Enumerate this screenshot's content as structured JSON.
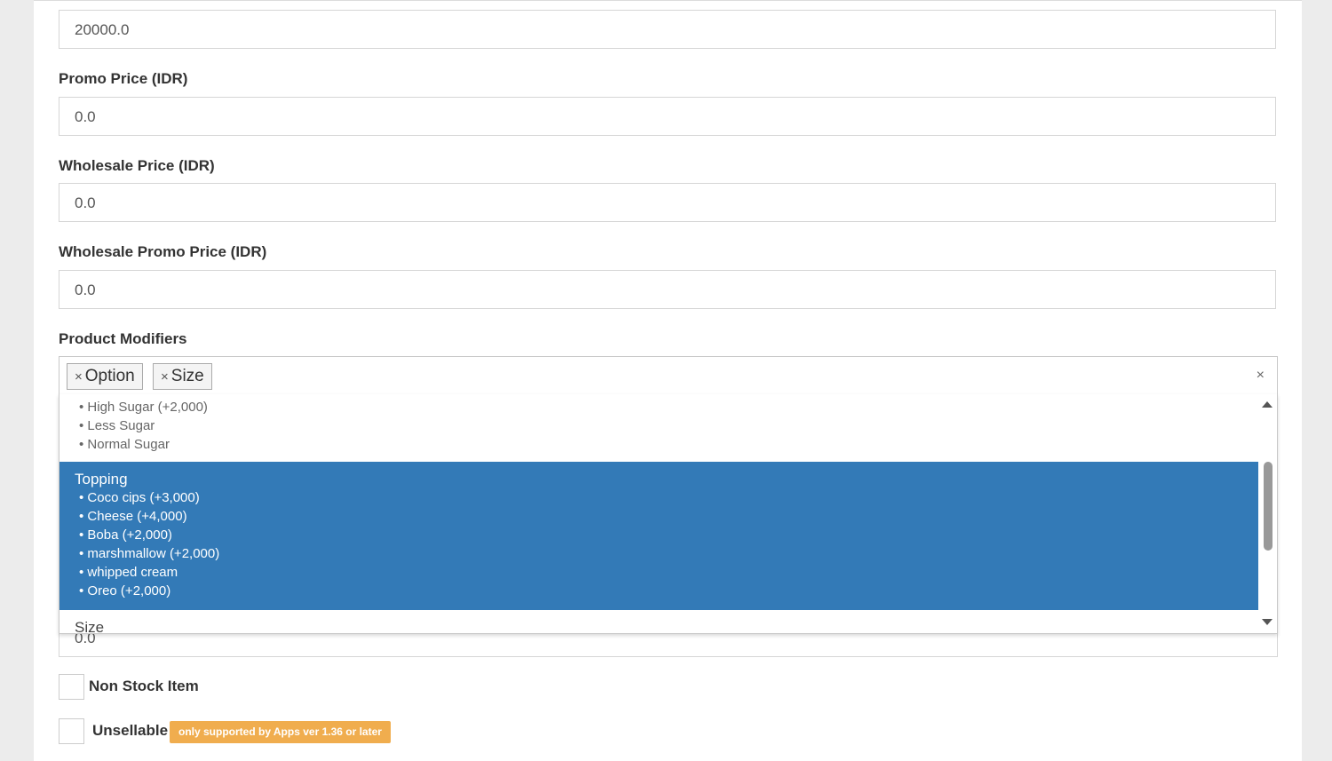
{
  "form": {
    "price_value": "20000.0",
    "promo_price_label": "Promo Price (IDR)",
    "promo_price_value": "0.0",
    "wholesale_price_label": "Wholesale Price (IDR)",
    "wholesale_price_value": "0.0",
    "wholesale_promo_label": "Wholesale Promo Price (IDR)",
    "wholesale_promo_value": "0.0",
    "modifiers_label": "Product Modifiers",
    "hidden_value": "0.0"
  },
  "modifiers": {
    "tags": [
      {
        "remove": "×",
        "label": "Option"
      },
      {
        "remove": "×",
        "label": "Size"
      }
    ],
    "clear": "×",
    "dropdown": {
      "prev_group_items": [
        "• High Sugar (+2,000)",
        "• Less Sugar",
        "• Normal Sugar"
      ],
      "highlighted_group": {
        "title": "Topping",
        "items": [
          "• Coco cips (+3,000)",
          "• Cheese (+4,000)",
          "• Boba (+2,000)",
          "• marshmallow (+2,000)",
          "• whipped cream",
          "• Oreo (+2,000)"
        ]
      },
      "next_group_title": "Size"
    }
  },
  "checkboxes": {
    "non_stock_label": "Non Stock Item",
    "unsellable_label": "Unsellable",
    "unsellable_badge": "only supported by Apps ver 1.36 or later"
  },
  "colors": {
    "highlight": "#337ab7",
    "badge": "#f0ad4e"
  }
}
